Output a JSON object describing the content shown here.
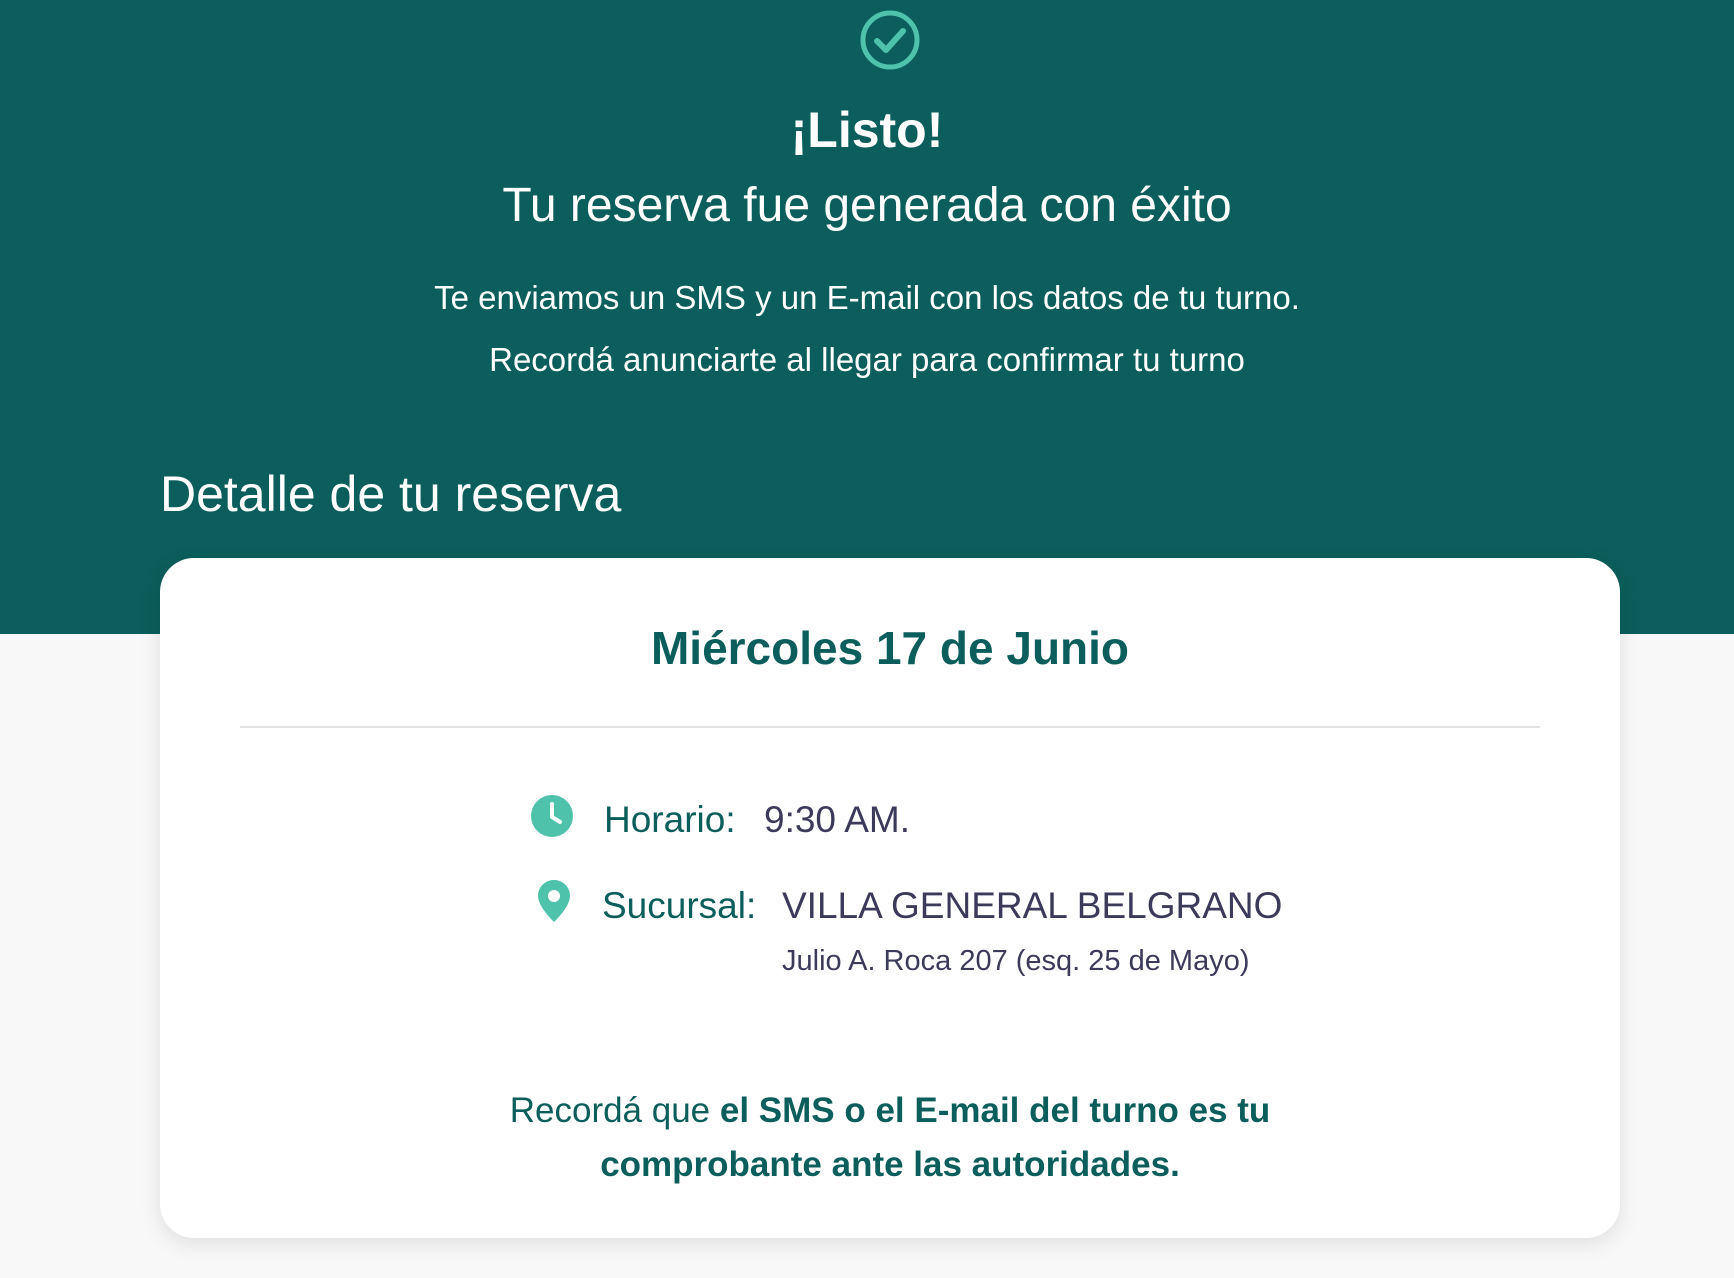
{
  "colors": {
    "brand": "#0b5e5b",
    "accent": "#4ec2ab",
    "text_dark": "#3b3a5a",
    "background": "#f8f8f8"
  },
  "header": {
    "icon": "check-circle-icon",
    "title": "¡Listo!",
    "subtitle": "Tu reserva fue generada con éxito",
    "message_line1": "Te enviamos un SMS y un E-mail con los datos de tu turno.",
    "message_line2": "Recordá anunciarte al llegar para confirmar tu turno"
  },
  "detail": {
    "heading": "Detalle de tu reserva",
    "date": "Miércoles 17 de Junio",
    "time": {
      "icon": "clock-icon",
      "label": "Horario:",
      "value": "9:30 AM."
    },
    "branch": {
      "icon": "map-pin-icon",
      "label": "Sucursal:",
      "value": "VILLA GENERAL BELGRANO",
      "address": "Julio A. Roca 207 (esq. 25 de Mayo)"
    },
    "reminder": {
      "prefix": "Recordá que ",
      "bold_line1": "el SMS o el E-mail del turno es tu",
      "bold_line2": "comprobante ante las autoridades."
    }
  }
}
